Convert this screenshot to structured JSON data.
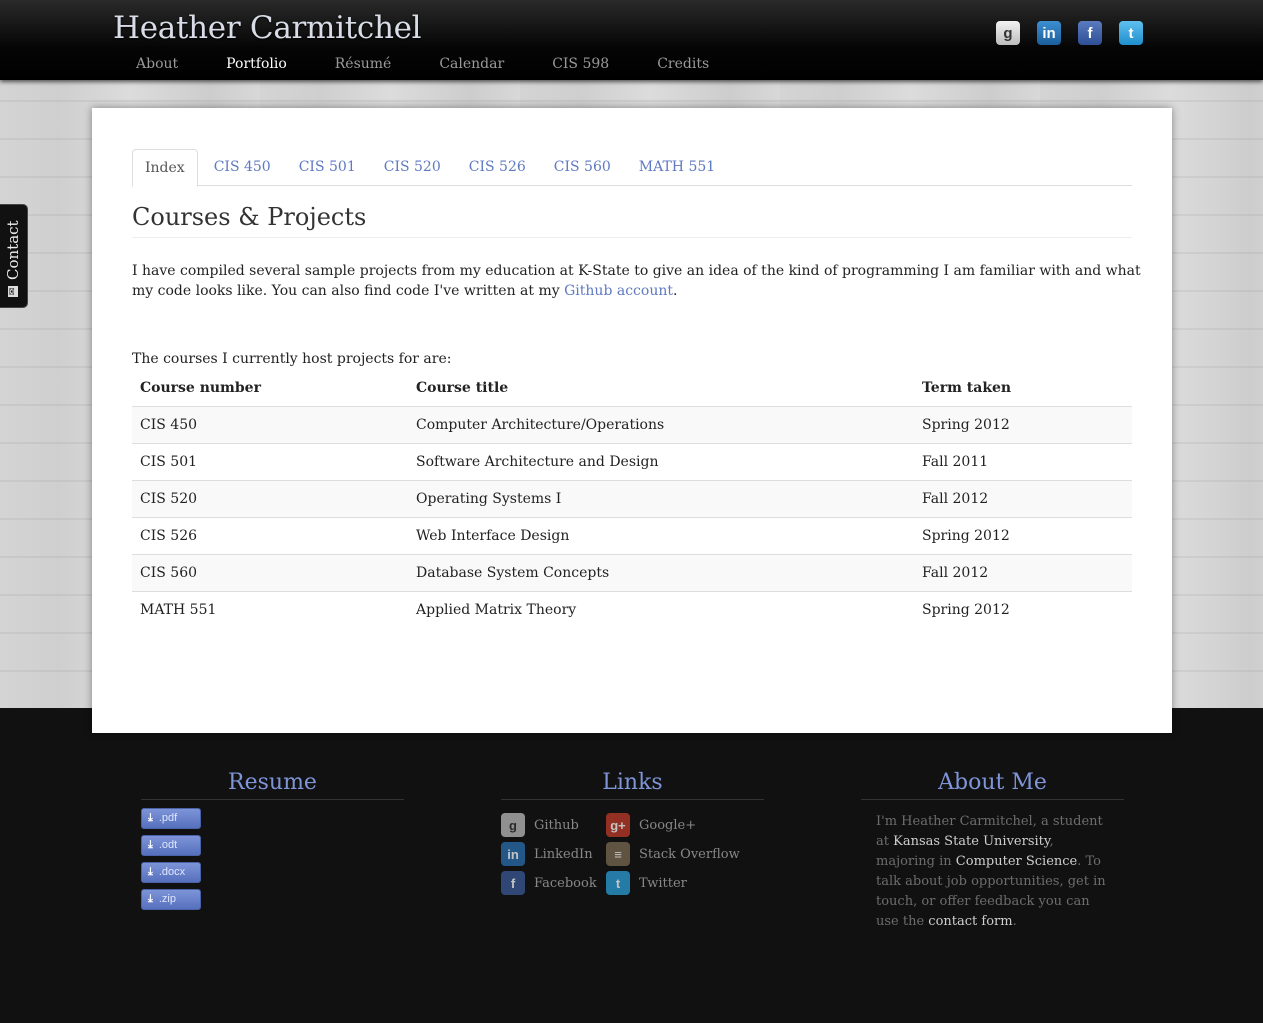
{
  "site": {
    "name": "Heather Carmitchel",
    "nav": [
      "About",
      "Portfolio",
      "Résumé",
      "Calendar",
      "CIS 598",
      "Credits"
    ],
    "active_nav": "Portfolio",
    "social_icons": [
      "github-icon",
      "linkedin-icon",
      "facebook-icon",
      "twitter-icon"
    ]
  },
  "contact_tab": {
    "label": "Contact"
  },
  "main": {
    "tabs": [
      "Index",
      "CIS 450",
      "CIS 501",
      "CIS 520",
      "CIS 526",
      "CIS 560",
      "MATH 551"
    ],
    "active_tab": "Index",
    "title": "Courses & Projects",
    "intro_1": "I have compiled several sample projects from my education at K-State to give an idea of the kind of programming I am familiar with and what my code looks like. You can also find code I've written at my ",
    "intro_link": "Github account",
    "intro_2": ".",
    "courses_lead": "The courses I currently host projects for are:",
    "table": {
      "headers": [
        "Course number",
        "Course title",
        "Term taken"
      ],
      "rows": [
        [
          "CIS 450",
          "Computer Architecture/Operations",
          "Spring 2012"
        ],
        [
          "CIS 501",
          "Software Architecture and Design",
          "Fall 2011"
        ],
        [
          "CIS 520",
          "Operating Systems I",
          "Fall 2012"
        ],
        [
          "CIS 526",
          "Web Interface Design",
          "Spring 2012"
        ],
        [
          "CIS 560",
          "Database System Concepts",
          "Fall 2012"
        ],
        [
          "MATH 551",
          "Applied Matrix Theory",
          "Spring 2012"
        ]
      ]
    }
  },
  "footer": {
    "resume": {
      "title": "Resume",
      "downloads": [
        ".pdf",
        ".odt",
        ".docx",
        ".zip"
      ]
    },
    "links": {
      "title": "Links",
      "items": [
        "Github",
        "Google+",
        "LinkedIn",
        "Stack Overflow",
        "Facebook",
        "Twitter"
      ]
    },
    "about": {
      "title": "About Me",
      "t1": "I'm Heather Carmitchel, a student at ",
      "school": "Kansas State University",
      "t2": ", majoring in ",
      "major": "Computer Science",
      "t3": ". To talk about job opportunities, get in touch, or offer feedback you can use the ",
      "form_link": "contact form",
      "t4": "."
    }
  },
  "colors": {
    "accent": "#5f79c2",
    "footer_heading": "#7f95d8",
    "navbar": "#000000"
  }
}
